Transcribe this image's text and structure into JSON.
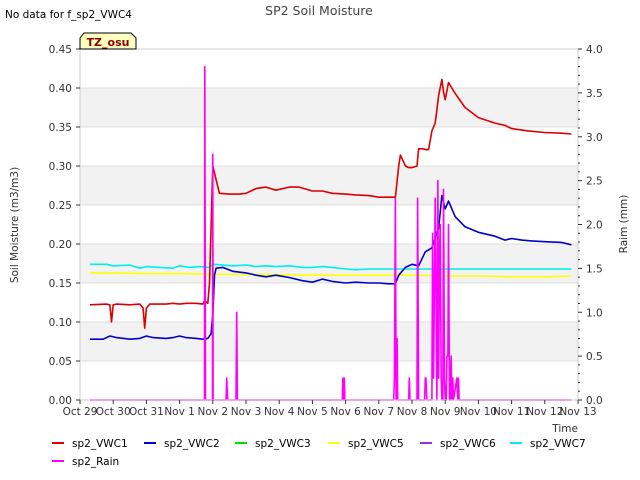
{
  "chart_data": {
    "type": "line",
    "title": "SP2 Soil Moisture",
    "note": "No data for f_sp2_VWC4",
    "badge": "TZ_osu",
    "xlabel": "Time",
    "ylabel": "Soil Moisture (m3/m3)",
    "y2label": "Raim (mm)",
    "xlim": [
      0,
      15
    ],
    "ylim": [
      0,
      0.45
    ],
    "y2lim": [
      0,
      4.0
    ],
    "x_ticks": [
      {
        "v": 0,
        "label": "Oct 29"
      },
      {
        "v": 1,
        "label": "Oct 30"
      },
      {
        "v": 2,
        "label": "Oct 31"
      },
      {
        "v": 3,
        "label": "Nov 1"
      },
      {
        "v": 4,
        "label": "Nov 2"
      },
      {
        "v": 5,
        "label": "Nov 3"
      },
      {
        "v": 6,
        "label": "Nov 4"
      },
      {
        "v": 7,
        "label": "Nov 5"
      },
      {
        "v": 8,
        "label": "Nov 6"
      },
      {
        "v": 9,
        "label": "Nov 7"
      },
      {
        "v": 10,
        "label": "Nov 8"
      },
      {
        "v": 11,
        "label": "Nov 9"
      },
      {
        "v": 12,
        "label": "Nov 10"
      },
      {
        "v": 13,
        "label": "Nov 11"
      },
      {
        "v": 14,
        "label": "Nov 12"
      },
      {
        "v": 15,
        "label": "Nov 13"
      }
    ],
    "y_ticks": [
      {
        "v": 0.0,
        "label": "0.00"
      },
      {
        "v": 0.05,
        "label": "0.05"
      },
      {
        "v": 0.1,
        "label": "0.10"
      },
      {
        "v": 0.15,
        "label": "0.15"
      },
      {
        "v": 0.2,
        "label": "0.20"
      },
      {
        "v": 0.25,
        "label": "0.25"
      },
      {
        "v": 0.3,
        "label": "0.30"
      },
      {
        "v": 0.35,
        "label": "0.35"
      },
      {
        "v": 0.4,
        "label": "0.40"
      },
      {
        "v": 0.45,
        "label": "0.45"
      }
    ],
    "y2_ticks": [
      {
        "v": 0.0,
        "label": "0.0"
      },
      {
        "v": 0.5,
        "label": "0.5"
      },
      {
        "v": 1.0,
        "label": "1.0"
      },
      {
        "v": 1.5,
        "label": "1.5"
      },
      {
        "v": 2.0,
        "label": "2.0"
      },
      {
        "v": 2.5,
        "label": "2.5"
      },
      {
        "v": 3.0,
        "label": "3.0"
      },
      {
        "v": 3.5,
        "label": "3.5"
      },
      {
        "v": 4.0,
        "label": "4.0"
      }
    ],
    "bands": [
      [
        0.05,
        0.1
      ],
      [
        0.15,
        0.2
      ],
      [
        0.25,
        0.3
      ],
      [
        0.35,
        0.4
      ]
    ],
    "legend_position": "bottom",
    "legend": [
      {
        "name": "sp2_VWC1",
        "color": "#dd0000"
      },
      {
        "name": "sp2_VWC2",
        "color": "#0000cc"
      },
      {
        "name": "sp2_VWC3",
        "color": "#00dd00"
      },
      {
        "name": "sp2_VWC5",
        "color": "#ffff00"
      },
      {
        "name": "sp2_VWC6",
        "color": "#9933dd"
      },
      {
        "name": "sp2_VWC7",
        "color": "#00eeee"
      },
      {
        "name": "sp2_Rain",
        "color": "#ff00ff"
      }
    ],
    "series": [
      {
        "name": "sp2_VWC1",
        "color": "#dd0000",
        "axis": "left",
        "x": [
          0.3,
          0.8,
          0.9,
          0.95,
          1.0,
          1.1,
          1.5,
          1.8,
          1.9,
          1.95,
          2.0,
          2.1,
          2.6,
          2.8,
          3.0,
          3.2,
          3.5,
          3.7,
          3.75,
          3.85,
          3.9,
          4.0,
          4.2,
          4.5,
          4.8,
          5.0,
          5.3,
          5.6,
          5.9,
          6.3,
          6.6,
          7.0,
          7.3,
          7.6,
          8.0,
          8.3,
          8.7,
          9.0,
          9.3,
          9.5,
          9.6,
          9.65,
          9.8,
          9.9,
          10.0,
          10.15,
          10.2,
          10.35,
          10.4,
          10.5,
          10.6,
          10.7,
          10.8,
          10.9,
          10.95,
          11.0,
          11.1,
          11.3,
          11.6,
          12.0,
          12.5,
          12.8,
          13.0,
          13.5,
          14.0,
          14.5,
          14.8
        ],
        "y": [
          0.122,
          0.123,
          0.122,
          0.1,
          0.122,
          0.123,
          0.122,
          0.123,
          0.118,
          0.092,
          0.118,
          0.123,
          0.123,
          0.124,
          0.123,
          0.124,
          0.124,
          0.123,
          0.127,
          0.124,
          0.15,
          0.3,
          0.265,
          0.264,
          0.264,
          0.265,
          0.271,
          0.273,
          0.269,
          0.273,
          0.273,
          0.268,
          0.268,
          0.265,
          0.264,
          0.263,
          0.262,
          0.26,
          0.26,
          0.26,
          0.3,
          0.314,
          0.3,
          0.298,
          0.298,
          0.3,
          0.322,
          0.322,
          0.321,
          0.321,
          0.345,
          0.355,
          0.39,
          0.411,
          0.395,
          0.385,
          0.407,
          0.393,
          0.375,
          0.362,
          0.355,
          0.352,
          0.348,
          0.345,
          0.343,
          0.342,
          0.341
        ]
      },
      {
        "name": "sp2_VWC2",
        "color": "#0000cc",
        "axis": "left",
        "x": [
          0.3,
          0.7,
          0.9,
          1.1,
          1.5,
          1.8,
          2.0,
          2.2,
          2.6,
          2.8,
          3.0,
          3.2,
          3.5,
          3.7,
          3.85,
          3.95,
          4.0,
          4.05,
          4.1,
          4.3,
          4.6,
          5.0,
          5.3,
          5.6,
          5.9,
          6.3,
          6.7,
          7.0,
          7.3,
          7.6,
          8.0,
          8.3,
          8.7,
          9.0,
          9.3,
          9.5,
          9.6,
          9.8,
          10.0,
          10.2,
          10.4,
          10.6,
          10.8,
          10.9,
          11.0,
          11.1,
          11.3,
          11.6,
          12.0,
          12.5,
          12.8,
          13.0,
          13.3,
          13.6,
          14.0,
          14.5,
          14.8
        ],
        "y": [
          0.078,
          0.078,
          0.082,
          0.08,
          0.078,
          0.079,
          0.082,
          0.08,
          0.079,
          0.08,
          0.082,
          0.08,
          0.079,
          0.078,
          0.079,
          0.085,
          0.11,
          0.16,
          0.169,
          0.17,
          0.165,
          0.163,
          0.16,
          0.158,
          0.16,
          0.157,
          0.153,
          0.151,
          0.155,
          0.152,
          0.15,
          0.151,
          0.15,
          0.15,
          0.149,
          0.149,
          0.16,
          0.17,
          0.174,
          0.172,
          0.19,
          0.195,
          0.22,
          0.262,
          0.245,
          0.255,
          0.235,
          0.222,
          0.215,
          0.21,
          0.205,
          0.207,
          0.205,
          0.204,
          0.203,
          0.202,
          0.199
        ]
      },
      {
        "name": "sp2_VWC5",
        "color": "#ffff00",
        "axis": "left",
        "x": [
          0.3,
          1.0,
          2.0,
          3.0,
          4.0,
          5.0,
          6.0,
          7.0,
          8.0,
          9.0,
          10.0,
          11.0,
          12.0,
          13.0,
          14.0,
          14.8
        ],
        "y": [
          0.163,
          0.163,
          0.162,
          0.162,
          0.161,
          0.161,
          0.161,
          0.16,
          0.16,
          0.16,
          0.16,
          0.159,
          0.159,
          0.158,
          0.158,
          0.159
        ]
      },
      {
        "name": "sp2_VWC7",
        "color": "#00eeee",
        "axis": "left",
        "x": [
          0.3,
          0.8,
          1.0,
          1.5,
          1.8,
          2.0,
          2.4,
          2.8,
          3.0,
          3.3,
          3.6,
          3.9,
          4.0,
          4.3,
          4.6,
          5.0,
          5.3,
          5.6,
          5.9,
          6.3,
          6.7,
          7.0,
          7.3,
          7.6,
          8.0,
          8.3,
          8.7,
          9.0,
          9.5,
          10.0,
          11.0,
          12.0,
          13.0,
          14.0,
          14.8
        ],
        "y": [
          0.174,
          0.174,
          0.172,
          0.173,
          0.169,
          0.171,
          0.17,
          0.169,
          0.172,
          0.17,
          0.171,
          0.17,
          0.174,
          0.173,
          0.172,
          0.173,
          0.171,
          0.172,
          0.171,
          0.172,
          0.17,
          0.17,
          0.171,
          0.17,
          0.168,
          0.167,
          0.168,
          0.168,
          0.168,
          0.168,
          0.168,
          0.168,
          0.168,
          0.168,
          0.168
        ]
      },
      {
        "name": "sp2_Rain",
        "color": "#ff00ff",
        "axis": "right",
        "x": [
          0.3,
          3.75,
          3.76,
          3.78,
          3.8,
          3.82,
          3.84,
          3.85,
          3.86,
          3.87,
          3.88,
          3.9,
          3.92,
          3.94,
          3.95,
          3.97,
          3.99,
          4.0,
          4.01,
          4.03,
          4.05,
          4.4,
          4.42,
          4.45,
          4.47,
          4.49,
          4.7,
          4.72,
          4.74,
          4.76,
          4.78,
          7.9,
          7.92,
          7.94,
          7.96,
          7.98,
          8.0,
          8.02,
          9.45,
          9.47,
          9.5,
          9.52,
          9.55,
          9.57,
          9.6,
          9.62,
          9.9,
          9.92,
          9.94,
          9.96,
          10.15,
          10.17,
          10.2,
          10.22,
          10.38,
          10.4,
          10.42,
          10.45,
          10.47,
          10.6,
          10.62,
          10.65,
          10.7,
          10.75,
          10.78,
          10.8,
          10.83,
          10.85,
          10.88,
          10.9,
          10.93,
          10.95,
          10.98,
          11.0,
          11.03,
          11.05,
          11.08,
          11.1,
          11.13,
          11.15,
          11.18,
          11.2,
          11.23,
          11.25,
          11.35,
          11.38,
          11.4,
          11.42,
          11.55,
          11.57,
          11.6,
          11.62,
          14.8
        ],
        "y": [
          0,
          0,
          3.8,
          0,
          0,
          0,
          0,
          0,
          0,
          0,
          0,
          0,
          0,
          0,
          0,
          0,
          0,
          2.8,
          0,
          0,
          0,
          0,
          0.25,
          0,
          0,
          0,
          0,
          1.0,
          0,
          0,
          0,
          0,
          0.25,
          0,
          0.25,
          0,
          0,
          0,
          0,
          0.25,
          2.3,
          0,
          0.7,
          0,
          0,
          0,
          0,
          0.25,
          0,
          0,
          0,
          2.3,
          0,
          0,
          0,
          0.25,
          0.25,
          0,
          0,
          0,
          1.9,
          0.25,
          2.3,
          0,
          2.5,
          0.25,
          1.7,
          2.0,
          0.25,
          0,
          0,
          2.4,
          0.25,
          0,
          0,
          0.5,
          0.5,
          2.0,
          0,
          0,
          0.5,
          0,
          0.25,
          0,
          0.25,
          0,
          0.25,
          0,
          0,
          0,
          0,
          0,
          0
        ]
      }
    ]
  }
}
